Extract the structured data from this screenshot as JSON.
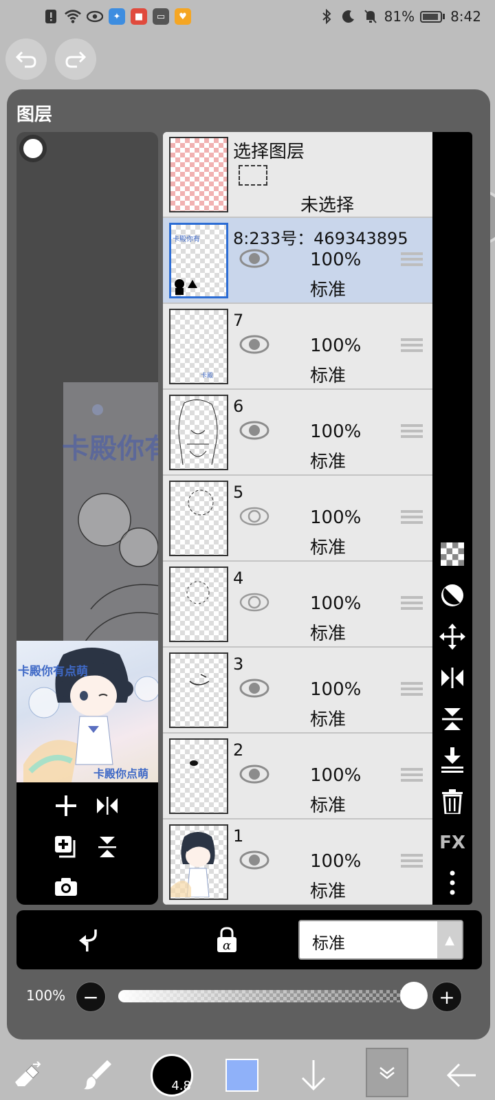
{
  "status_bar": {
    "battery": "81%",
    "time": "8:42",
    "icons_left": [
      "alert-icon",
      "wifi-icon",
      "eye-icon",
      "cleaner-app-icon",
      "shop-app-icon",
      "inbox-app-icon",
      "heart-app-icon"
    ],
    "icons_right": [
      "bluetooth-icon",
      "moon-icon",
      "mute-icon",
      "battery-icon"
    ]
  },
  "panel": {
    "title": "图层"
  },
  "canvas_preview": {
    "art_title": "卡殿你有点萌",
    "art_subtitle": "卡殿你点萌",
    "ghost_text": "卡殿你有"
  },
  "select_layer": {
    "title": "选择图层",
    "status": "未选择"
  },
  "layers": [
    {
      "name": "8:233号：469343895",
      "opacity": "100%",
      "blend": "标准",
      "visible": true,
      "selected": true
    },
    {
      "name": "7",
      "opacity": "100%",
      "blend": "标准",
      "visible": true,
      "selected": false
    },
    {
      "name": "6",
      "opacity": "100%",
      "blend": "标准",
      "visible": true,
      "selected": false
    },
    {
      "name": "5",
      "opacity": "100%",
      "blend": "标准",
      "visible": false,
      "selected": false
    },
    {
      "name": "4",
      "opacity": "100%",
      "blend": "标准",
      "visible": false,
      "selected": false
    },
    {
      "name": "3",
      "opacity": "100%",
      "blend": "标准",
      "visible": true,
      "selected": false
    },
    {
      "name": "2",
      "opacity": "100%",
      "blend": "标准",
      "visible": true,
      "selected": false
    },
    {
      "name": "1",
      "opacity": "100%",
      "blend": "标准",
      "visible": true,
      "selected": false
    }
  ],
  "right_toolbar": {
    "fx_label": "FX"
  },
  "blend_mode": {
    "selected": "标准"
  },
  "opacity_control": {
    "label": "100%",
    "minus": "−",
    "plus": "+",
    "level": 1.0
  },
  "bottom_bar": {
    "brush_size": "4.8",
    "color": "#8fb1f9"
  }
}
